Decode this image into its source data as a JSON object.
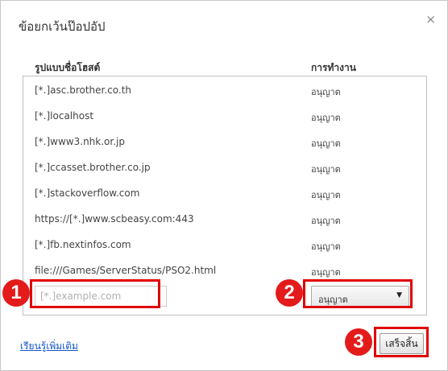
{
  "dialog": {
    "title": "ข้อยกเว้นป๊อปอัป",
    "close_glyph": "×"
  },
  "columns": {
    "host_pattern": "รูปแบบชื่อโฮสต์",
    "action": "การทำงาน"
  },
  "rows": [
    {
      "host": "[*.]asc.brother.co.th",
      "action": "อนุญาต"
    },
    {
      "host": "[*.]localhost",
      "action": "อนุญาต"
    },
    {
      "host": "[*.]www3.nhk.or.jp",
      "action": "อนุญาต"
    },
    {
      "host": "[*.]ccasset.brother.co.jp",
      "action": "อนุญาต"
    },
    {
      "host": "[*.]stackoverflow.com",
      "action": "อนุญาต"
    },
    {
      "host": "https://[*.]www.scbeasy.com:443",
      "action": "อนุญาต"
    },
    {
      "host": "[*.]fb.nextinfos.com",
      "action": "อนุญาต"
    },
    {
      "host": "file:///Games/ServerStatus/PSO2.html",
      "action": "อนุญาต"
    }
  ],
  "new_entry": {
    "placeholder": "[*.]example.com",
    "value": "",
    "action_selected": "อนุญาต"
  },
  "footer": {
    "learn_more": "เรียนรู้เพิ่มเติม",
    "done": "เสร็จสิ้น"
  },
  "annotations": {
    "badge_1": "1",
    "badge_2": "2",
    "badge_3": "3",
    "color": "#e00000"
  }
}
